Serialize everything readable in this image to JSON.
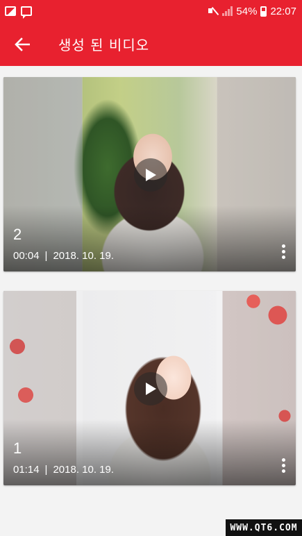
{
  "status_bar": {
    "battery": "54%",
    "time": "22:07"
  },
  "app_bar": {
    "title": "생성 된 비디오"
  },
  "videos": [
    {
      "title": "2",
      "duration": "00:04",
      "separator": "|",
      "date": "2018. 10. 19."
    },
    {
      "title": "1",
      "duration": "01:14",
      "separator": "|",
      "date": "2018. 10. 19."
    }
  ],
  "watermark": "WWW.QT6.COM",
  "colors": {
    "primary": "#e8212f",
    "background": "#f3f3f3"
  }
}
